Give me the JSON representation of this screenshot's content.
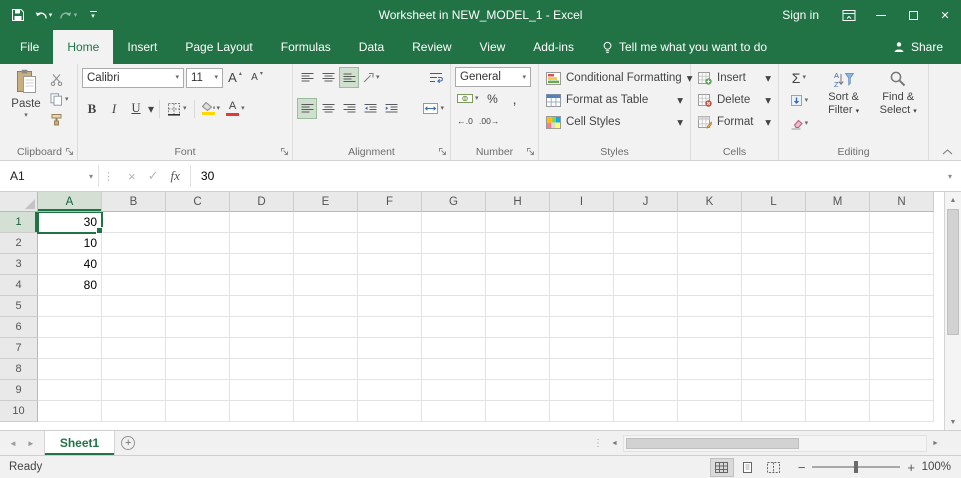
{
  "colors": {
    "accent_green": "#217346",
    "ribbon_background": "#f2f2f2",
    "selected_header_background": "#d3e0d3",
    "fill_color_swatch": "#ffd800",
    "font_color_swatch": "#e03b32"
  },
  "icons": {
    "dropdown": "▾",
    "small_up": "▴",
    "close": "×",
    "cancel": "×",
    "check": "✓",
    "scroll_up": "▲",
    "scroll_down": "▼",
    "scroll_left": "◄",
    "scroll_right": "►",
    "sheet_nav_left": "◄",
    "sheet_nav_right": "►",
    "add": "+",
    "zoom_out": "−",
    "zoom_in": "+",
    "splitter_dots": "⋮"
  },
  "title_bar": {
    "title": "Worksheet in NEW_MODEL_1 - Excel",
    "sign_in_label": "Sign in"
  },
  "tab_bar": {
    "tabs": [
      "File",
      "Home",
      "Insert",
      "Page Layout",
      "Formulas",
      "Data",
      "Review",
      "View",
      "Add-ins"
    ],
    "active_tab": "Home",
    "tell_me_label": "Tell me what you want to do",
    "share_label": "Share"
  },
  "ribbon": {
    "clipboard": {
      "paste_label": "Paste",
      "group_label": "Clipboard"
    },
    "font": {
      "font_name": "Calibri",
      "font_size": "11",
      "bold_label": "B",
      "italic_label": "I",
      "underline_label": "U",
      "grow_font_label": "A",
      "shrink_font_label": "A",
      "group_label": "Font"
    },
    "alignment": {
      "group_label": "Alignment"
    },
    "number": {
      "format_value": "General",
      "percent_label": "%",
      "comma_label": ",",
      "increase_decimal_label": "←.0",
      "decrease_decimal_label": ".00→",
      "group_label": "Number"
    },
    "styles": {
      "conditional_formatting_label": "Conditional Formatting",
      "format_as_table_label": "Format as Table",
      "cell_styles_label": "Cell Styles",
      "group_label": "Styles"
    },
    "cells": {
      "insert_label": "Insert",
      "delete_label": "Delete",
      "format_label": "Format",
      "group_label": "Cells"
    },
    "editing": {
      "autosum_label": "Σ",
      "sort_filter_label": "Sort & Filter",
      "find_select_label": "Find & Select",
      "group_label": "Editing"
    }
  },
  "formula_bar": {
    "name_box_value": "A1",
    "fx_label": "fx",
    "formula_value": "30"
  },
  "grid": {
    "columns": [
      "A",
      "B",
      "C",
      "D",
      "E",
      "F",
      "G",
      "H",
      "I",
      "J",
      "K",
      "L",
      "M",
      "N"
    ],
    "row_count": 10,
    "selected_cell": "A1",
    "selected_column": "A",
    "selected_row": "1",
    "cells": {
      "A1": "30",
      "A2": "10",
      "A3": "40",
      "A4": "80"
    }
  },
  "sheet_bar": {
    "sheet_tabs": [
      {
        "label": "Sheet1",
        "active": true
      }
    ]
  },
  "status_bar": {
    "status_label": "Ready",
    "zoom_label": "100%"
  }
}
